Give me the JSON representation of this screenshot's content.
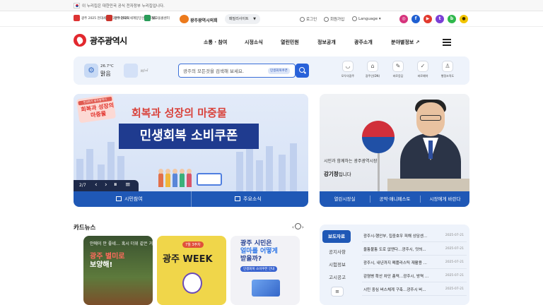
{
  "gov_banner": {
    "text": "이 누리집은 대한민국 공식 전자정부 누리집입니다."
  },
  "topbar": {
    "partner_logos": [
      "광주 2025 현대세계탁구선수권대회",
      "광주 2025 세계양궁선수권대회",
      "빛고을콜센터"
    ],
    "council": "광주광역시의회",
    "family_site": "패밀리사이트",
    "login": "로그인",
    "signup": "회원가입",
    "language": "Language",
    "sns": [
      {
        "name": "instagram",
        "color": "#d6337c"
      },
      {
        "name": "facebook",
        "color": "#1f5fd1"
      },
      {
        "name": "youtube",
        "color": "#e23a2e"
      },
      {
        "name": "talk",
        "color": "#7a3fd6"
      },
      {
        "name": "blog",
        "color": "#2fb84c"
      },
      {
        "name": "kakao",
        "color": "#f2c400"
      }
    ]
  },
  "header": {
    "logo": "광주광역시",
    "nav": [
      "소통 · 참여",
      "시정소식",
      "열린민원",
      "정보공개",
      "광주소개",
      "분야별정보"
    ]
  },
  "weather": {
    "temp": "26.7°C",
    "condition": "맑음",
    "dust_unit": "㎍/㎥"
  },
  "search": {
    "placeholder": "광주의 모든것을 검색해 보세요.",
    "tag": "민생회복쿠폰"
  },
  "quick_links": [
    "모두의광주",
    "광주인(DN)",
    "바로응답",
    "바로예약",
    "행정조직도"
  ],
  "banner": {
    "stamp_top": "민선8기 광주광역시",
    "stamp_main": "회복과 성장의 마중물",
    "headline": "회복과 성장의 마중물",
    "coupon": "민생회복 소비쿠폰",
    "page": "2/7",
    "tabs": [
      "시민참여",
      "주요소식"
    ]
  },
  "mayor": {
    "caption": "시민과 함께하는 광주광역시장",
    "name": "강기정",
    "suffix": "입니다",
    "tabs": [
      "열린시장실",
      "공약·매니페스토",
      "시장에게 바란다"
    ]
  },
  "cardnews": {
    "title": "카드뉴스",
    "cards": [
      {
        "top": "안에이 안 좋네… 혹시 더위 같은 거 티?",
        "headline_1": "광주 별미로",
        "headline_2": "보양해!"
      },
      {
        "pill": "7월 3주차",
        "headline": "광주 WEEK"
      },
      {
        "headline_1": "광주 시민은",
        "headline_2": "얼마를 어떻게",
        "headline_3": "받을까?",
        "pill": "민생회복 소비쿠폰 안내"
      }
    ]
  },
  "news": {
    "tabs": [
      "보도자료",
      "공지사항",
      "시험정보",
      "고시공고"
    ],
    "more": "≡",
    "items": [
      {
        "title": "광주시-행안부, 집중호우 피해 상담센...",
        "date": "2025-07-21"
      },
      {
        "title": "울퉁불퉁 도로 없앤다…광주시, 덧씌...",
        "date": "2025-07-21"
      },
      {
        "title": "광주시, 내년까지 폐플라스틱 재활용 ...",
        "date": "2025-07-21"
      },
      {
        "title": "감염병 확산 차단 총력…광주시, 방역 ...",
        "date": "2025-07-21"
      },
      {
        "title": "시민 중심 버스체계 구축…광주시 버...",
        "date": "2025-07-21"
      }
    ]
  }
}
